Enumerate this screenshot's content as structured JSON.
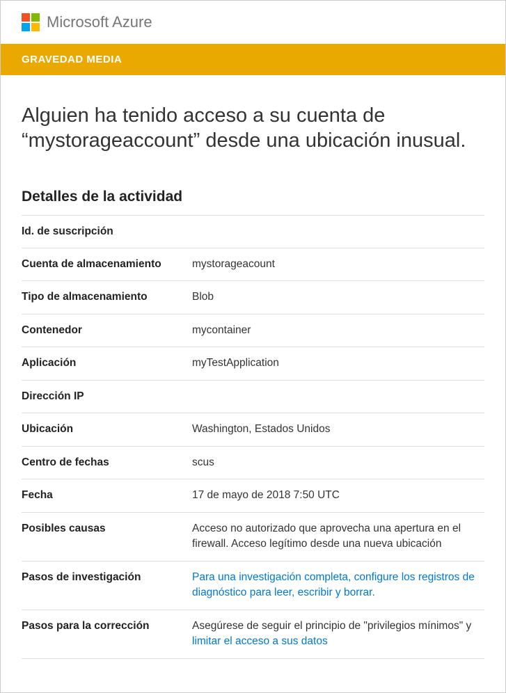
{
  "brand": "Microsoft Azure",
  "severity": "GRAVEDAD MEDIA",
  "title": "Alguien ha tenido acceso a su cuenta de “mystorageaccount” desde una ubicación inusual.",
  "sectionTitle": "Detalles de la actividad",
  "rows": {
    "subscriptionId": {
      "label": "Id. de suscripción",
      "value": ""
    },
    "storageAccount": {
      "label": "Cuenta de almacenamiento",
      "value": "mystorageacount"
    },
    "storageType": {
      "label": "Tipo de almacenamiento",
      "value": "Blob"
    },
    "container": {
      "label": "Contenedor",
      "value": "mycontainer"
    },
    "application": {
      "label": "Aplicación",
      "value": "myTestApplication"
    },
    "ip": {
      "label": "Dirección IP",
      "value": ""
    },
    "location": {
      "label": "Ubicación",
      "value": "Washington, Estados Unidos"
    },
    "datacenter": {
      "label": "Centro de fechas",
      "value": "scus"
    },
    "date": {
      "label": "Fecha",
      "value": "17 de mayo de 2018 7:50 UTC"
    },
    "possibleCauses": {
      "label": "Posibles causas",
      "value": "Acceso no autorizado que aprovecha una apertura en el firewall. Acceso legítimo desde una nueva ubicación"
    },
    "investigation": {
      "label": "Pasos de investigación",
      "linkText": "Para una investigación completa, configure los registros de diagnóstico para leer, escribir y borrar."
    },
    "remediation": {
      "label": "Pasos para la corrección",
      "prefix": "Asegúrese de seguir el principio de \"privilegios mínimos\" y ",
      "linkText": "limitar el acceso a sus datos"
    }
  }
}
